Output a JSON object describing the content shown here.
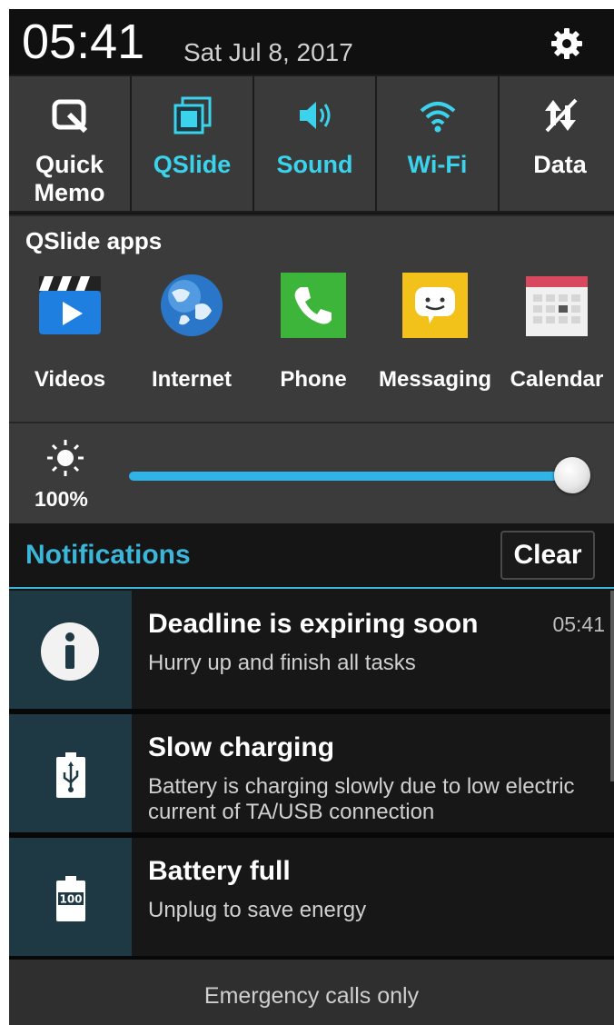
{
  "status": {
    "time": "05:41",
    "date": "Sat Jul 8, 2017"
  },
  "toggles": [
    {
      "label": "Quick\nMemo",
      "icon": "quick-memo-icon",
      "active": false
    },
    {
      "label": "QSlide",
      "icon": "qslide-icon",
      "active": true
    },
    {
      "label": "Sound",
      "icon": "sound-icon",
      "active": true
    },
    {
      "label": "Wi-Fi",
      "icon": "wifi-icon",
      "active": true
    },
    {
      "label": "Data",
      "icon": "data-icon",
      "active": false
    }
  ],
  "qslide": {
    "title": "QSlide apps",
    "apps": [
      {
        "label": "Videos",
        "icon": "videos-icon"
      },
      {
        "label": "Internet",
        "icon": "internet-icon"
      },
      {
        "label": "Phone",
        "icon": "phone-icon"
      },
      {
        "label": "Messaging",
        "icon": "messaging-icon"
      },
      {
        "label": "Calendar",
        "icon": "calendar-icon"
      }
    ]
  },
  "brightness": {
    "label": "100%",
    "level": 1.0
  },
  "notifications": {
    "title": "Notifications",
    "clear_label": "Clear",
    "items": [
      {
        "title": "Deadline is expiring soon",
        "body": "Hurry up and finish all tasks",
        "time": "05:41",
        "icon": "info-icon"
      },
      {
        "title": "Slow charging",
        "body": "Battery is charging slowly due to low electric current of TA/USB connection",
        "time": "",
        "icon": "usb-battery-icon"
      },
      {
        "title": "Battery full",
        "body": "Unplug to save energy",
        "time": "",
        "icon": "battery-full-icon"
      }
    ]
  },
  "footer": {
    "text": "Emergency calls only"
  },
  "colors": {
    "accent": "#3bb6d9",
    "toggle_on": "#3bd3ec",
    "slider": "#2eb4e6"
  }
}
